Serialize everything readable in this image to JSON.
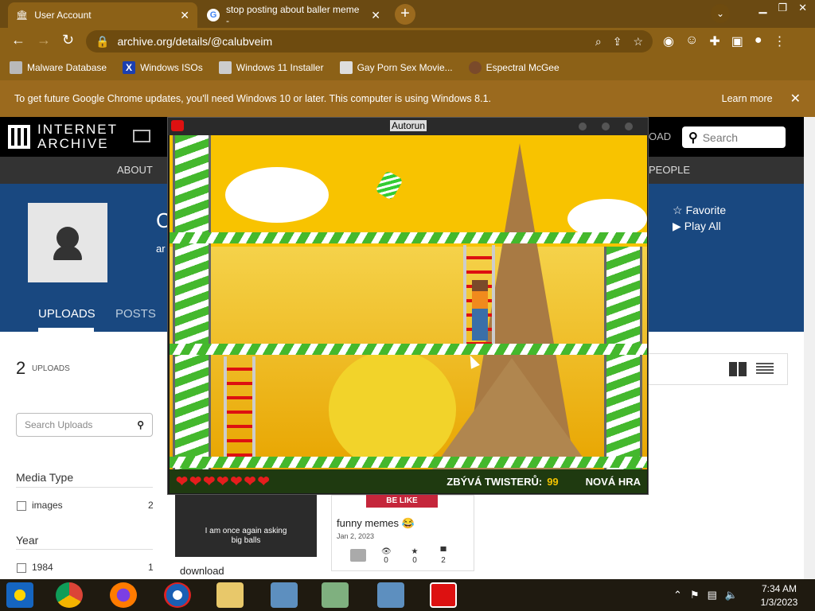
{
  "browser": {
    "tabs": [
      {
        "title": "User Account",
        "active": true
      },
      {
        "title": "stop posting about baller meme -",
        "active": false
      }
    ],
    "url": "archive.org/details/@calubveim",
    "bookmarks": [
      "Malware Database",
      "Windows ISOs",
      "Windows 11 Installer",
      "Gay Porn Sex Movie...",
      "Espectral McGee"
    ],
    "infobar": {
      "message": "To get future Google Chrome updates, you'll need Windows 10 or later. This computer is using Windows 8.1.",
      "learn_more": "Learn more"
    }
  },
  "archive": {
    "logo_line1": "INTERNET",
    "logo_line2": "ARCHIVE",
    "upload_partial": "OAD",
    "search_placeholder": "Search",
    "nav": {
      "about": "ABOUT",
      "people": "PEOPLE"
    },
    "profile": {
      "initial": "C",
      "sub": "ar",
      "favorite": "Favorite",
      "play_all": "Play All"
    },
    "tabs": {
      "uploads": "UPLOADS",
      "posts": "POSTS"
    },
    "uploads_count": "2",
    "uploads_label": "UPLOADS",
    "search_uploads_placeholder": "Search Uploads",
    "facets": {
      "media_type_title": "Media Type",
      "media_items": [
        {
          "label": "images",
          "count": "2"
        }
      ],
      "year_title": "Year",
      "year_items": [
        {
          "label": "1984",
          "count": "1"
        }
      ]
    },
    "items": [
      {
        "overlay_text": "I am once again asking big balls",
        "title": "download"
      },
      {
        "banner": "BE LIKE",
        "title": "funny memes 😂",
        "date": "Jan 2, 2023",
        "stats": [
          "0",
          "0",
          "2"
        ]
      }
    ]
  },
  "game": {
    "window_title": "Autorun",
    "hud_label": "ZBÝVÁ TWISTERŮ:",
    "hud_value": "99",
    "new_game": "NOVÁ HRA",
    "lives": 7
  },
  "taskbar": {
    "time": "7:34 AM",
    "date": "1/3/2023"
  }
}
